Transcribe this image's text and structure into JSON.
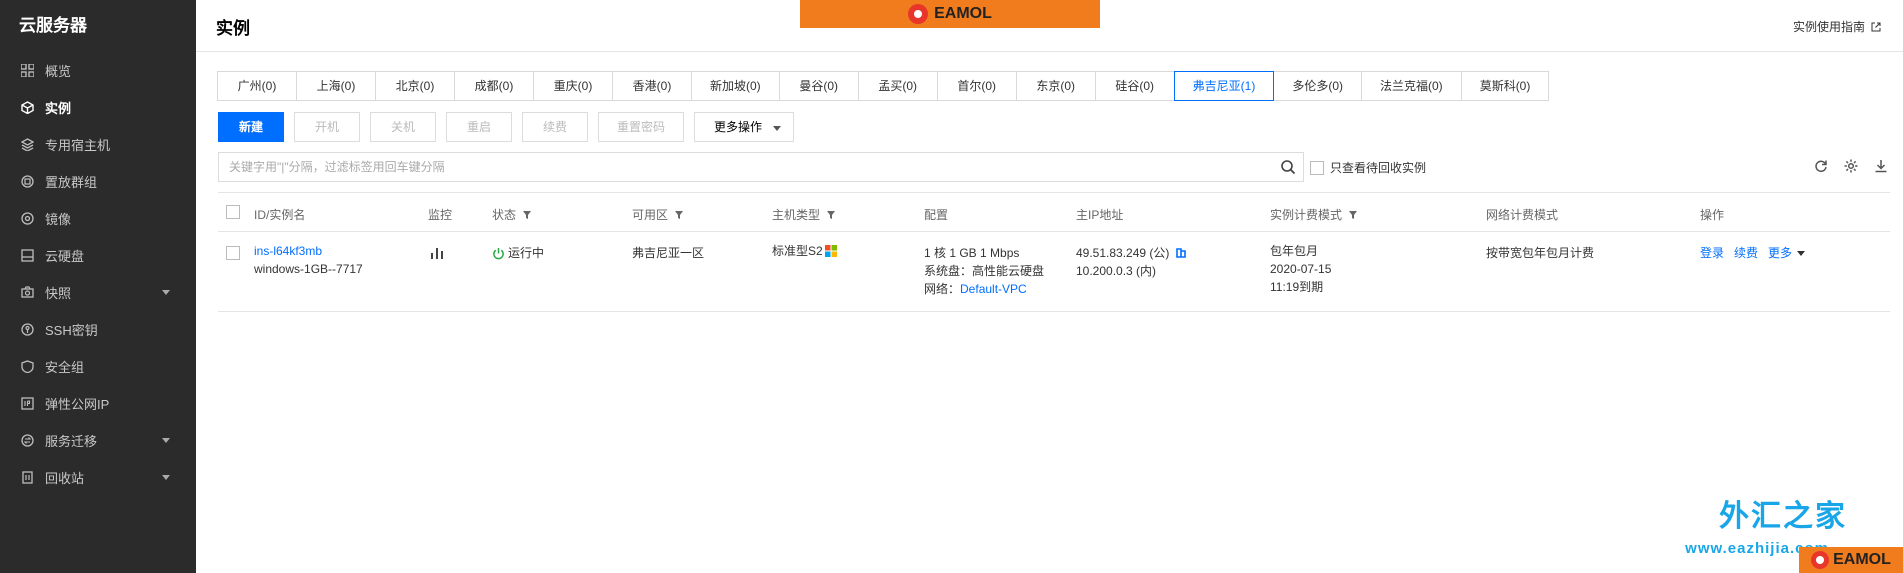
{
  "sidebar": {
    "brand": "云服务器",
    "items": [
      {
        "label": "概览",
        "icon": "grid-icon",
        "active": false,
        "caret": false
      },
      {
        "label": "实例",
        "icon": "cube-icon",
        "active": true,
        "caret": false
      },
      {
        "label": "专用宿主机",
        "icon": "layers-icon",
        "active": false,
        "caret": false
      },
      {
        "label": "置放群组",
        "icon": "group-icon",
        "active": false,
        "caret": false
      },
      {
        "label": "镜像",
        "icon": "disc-icon",
        "active": false,
        "caret": false
      },
      {
        "label": "云硬盘",
        "icon": "disk-icon",
        "active": false,
        "caret": false
      },
      {
        "label": "快照",
        "icon": "camera-icon",
        "active": false,
        "caret": true
      },
      {
        "label": "SSH密钥",
        "icon": "key-icon",
        "active": false,
        "caret": false
      },
      {
        "label": "安全组",
        "icon": "shield-icon",
        "active": false,
        "caret": false
      },
      {
        "label": "弹性公网IP",
        "icon": "ip-icon",
        "active": false,
        "caret": false
      },
      {
        "label": "服务迁移",
        "icon": "migrate-icon",
        "active": false,
        "caret": true
      },
      {
        "label": "回收站",
        "icon": "trash-icon",
        "active": false,
        "caret": true
      }
    ]
  },
  "header": {
    "title": "实例",
    "guide": "实例使用指南"
  },
  "watermark": {
    "brand": "EAMOL",
    "zh": "外汇之家",
    "url": "www.eazhijia.com",
    "brand_color": "#f07c1e"
  },
  "regions": [
    {
      "label": "广州(0)",
      "active": false
    },
    {
      "label": "上海(0)",
      "active": false
    },
    {
      "label": "北京(0)",
      "active": false
    },
    {
      "label": "成都(0)",
      "active": false
    },
    {
      "label": "重庆(0)",
      "active": false
    },
    {
      "label": "香港(0)",
      "active": false
    },
    {
      "label": "新加坡(0)",
      "active": false
    },
    {
      "label": "曼谷(0)",
      "active": false
    },
    {
      "label": "孟买(0)",
      "active": false
    },
    {
      "label": "首尔(0)",
      "active": false
    },
    {
      "label": "东京(0)",
      "active": false
    },
    {
      "label": "硅谷(0)",
      "active": false
    },
    {
      "label": "弗吉尼亚(1)",
      "active": true
    },
    {
      "label": "多伦多(0)",
      "active": false
    },
    {
      "label": "法兰克福(0)",
      "active": false
    },
    {
      "label": "莫斯科(0)",
      "active": false
    }
  ],
  "toolbar": {
    "new": "新建",
    "start": "开机",
    "stop": "关机",
    "restart": "重启",
    "renew": "续费",
    "reset_pwd": "重置密码",
    "more": "更多操作"
  },
  "search": {
    "placeholder": "关键字用\"|\"分隔，过滤标签用回车键分隔",
    "recycle_label": "只查看待回收实例"
  },
  "table": {
    "headers": {
      "id": "ID/实例名",
      "monitor": "监控",
      "status": "状态",
      "zone": "可用区",
      "type": "主机类型",
      "config": "配置",
      "ip": "主IP地址",
      "billing": "实例计费模式",
      "net_billing": "网络计费模式",
      "ops": "操作"
    },
    "rows": [
      {
        "id": "ins-l64kf3mb",
        "name": "windows-1GB--7717",
        "status": "运行中",
        "zone": "弗吉尼亚一区",
        "type": "标准型S2",
        "config_line1": "1 核 1 GB 1 Mbps",
        "config_line2": "系统盘：高性能云硬盘",
        "config_net_label": "网络：",
        "config_net": "Default-VPC",
        "ip_public": "49.51.83.249 (公)",
        "ip_private": "10.200.0.3 (内)",
        "billing_mode": "包年包月",
        "billing_date": "2020-07-15",
        "billing_expire": "11:19到期",
        "net_billing": "按带宽包年包月计费",
        "op_login": "登录",
        "op_renew": "续费",
        "op_more": "更多"
      }
    ]
  }
}
